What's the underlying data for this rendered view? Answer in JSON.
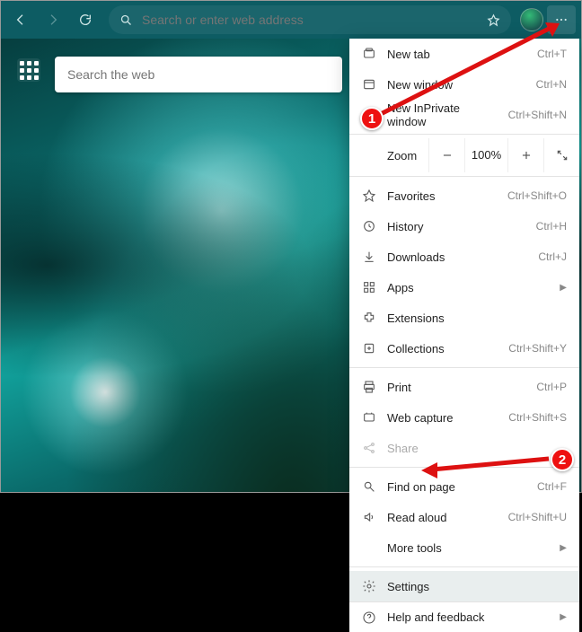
{
  "toolbar": {
    "address_placeholder": "Search or enter web address"
  },
  "ntp": {
    "search_placeholder": "Search the web"
  },
  "zoom": {
    "label": "Zoom",
    "value": "100%"
  },
  "menu": {
    "new_tab": {
      "label": "New tab",
      "shortcut": "Ctrl+T"
    },
    "new_window": {
      "label": "New window",
      "shortcut": "Ctrl+N"
    },
    "new_inprivate": {
      "label": "New InPrivate window",
      "shortcut": "Ctrl+Shift+N"
    },
    "favorites": {
      "label": "Favorites",
      "shortcut": "Ctrl+Shift+O"
    },
    "history": {
      "label": "History",
      "shortcut": "Ctrl+H"
    },
    "downloads": {
      "label": "Downloads",
      "shortcut": "Ctrl+J"
    },
    "apps": {
      "label": "Apps"
    },
    "extensions": {
      "label": "Extensions"
    },
    "collections": {
      "label": "Collections",
      "shortcut": "Ctrl+Shift+Y"
    },
    "print": {
      "label": "Print",
      "shortcut": "Ctrl+P"
    },
    "web_capture": {
      "label": "Web capture",
      "shortcut": "Ctrl+Shift+S"
    },
    "share": {
      "label": "Share"
    },
    "find": {
      "label": "Find on page",
      "shortcut": "Ctrl+F"
    },
    "read_aloud": {
      "label": "Read aloud",
      "shortcut": "Ctrl+Shift+U"
    },
    "more_tools": {
      "label": "More tools"
    },
    "settings": {
      "label": "Settings"
    },
    "help": {
      "label": "Help and feedback"
    }
  },
  "annotations": {
    "step1": "1",
    "step2": "2"
  }
}
